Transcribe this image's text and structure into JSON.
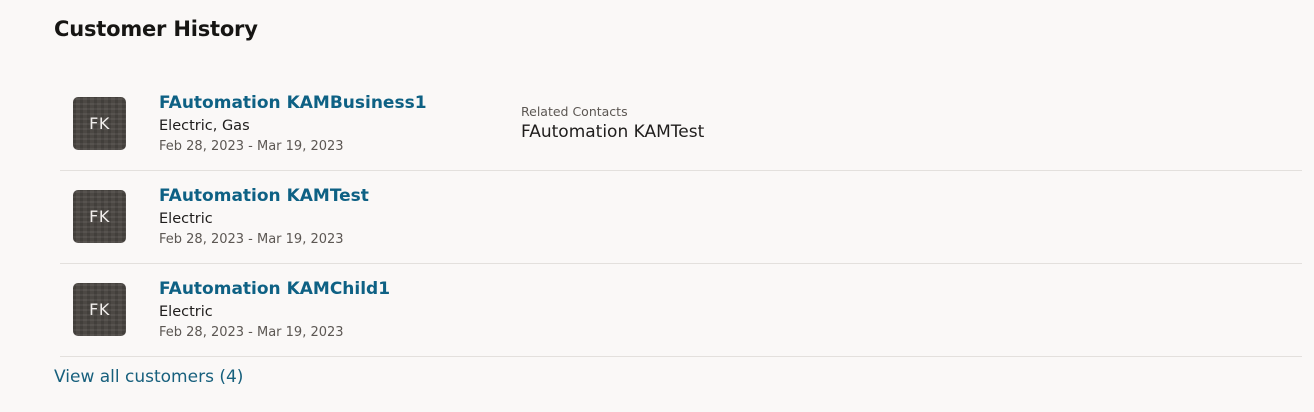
{
  "section": {
    "title": "Customer History"
  },
  "customers": [
    {
      "initials": "FK",
      "name": "FAutomation KAMBusiness1",
      "services": "Electric, Gas",
      "dates": "Feb 28, 2023 - Mar 19, 2023",
      "related_contacts_label": "Related Contacts",
      "related_contacts_value": "FAutomation KAMTest"
    },
    {
      "initials": "FK",
      "name": "FAutomation KAMTest",
      "services": "Electric",
      "dates": "Feb 28, 2023 - Mar 19, 2023"
    },
    {
      "initials": "FK",
      "name": "FAutomation KAMChild1",
      "services": "Electric",
      "dates": "Feb 28, 2023 - Mar 19, 2023"
    }
  ],
  "footer": {
    "view_all_label": "View all customers (4)"
  },
  "colors": {
    "link": "#0e6184",
    "avatar_bg": "#4a4642",
    "page_bg": "#faf8f7"
  }
}
